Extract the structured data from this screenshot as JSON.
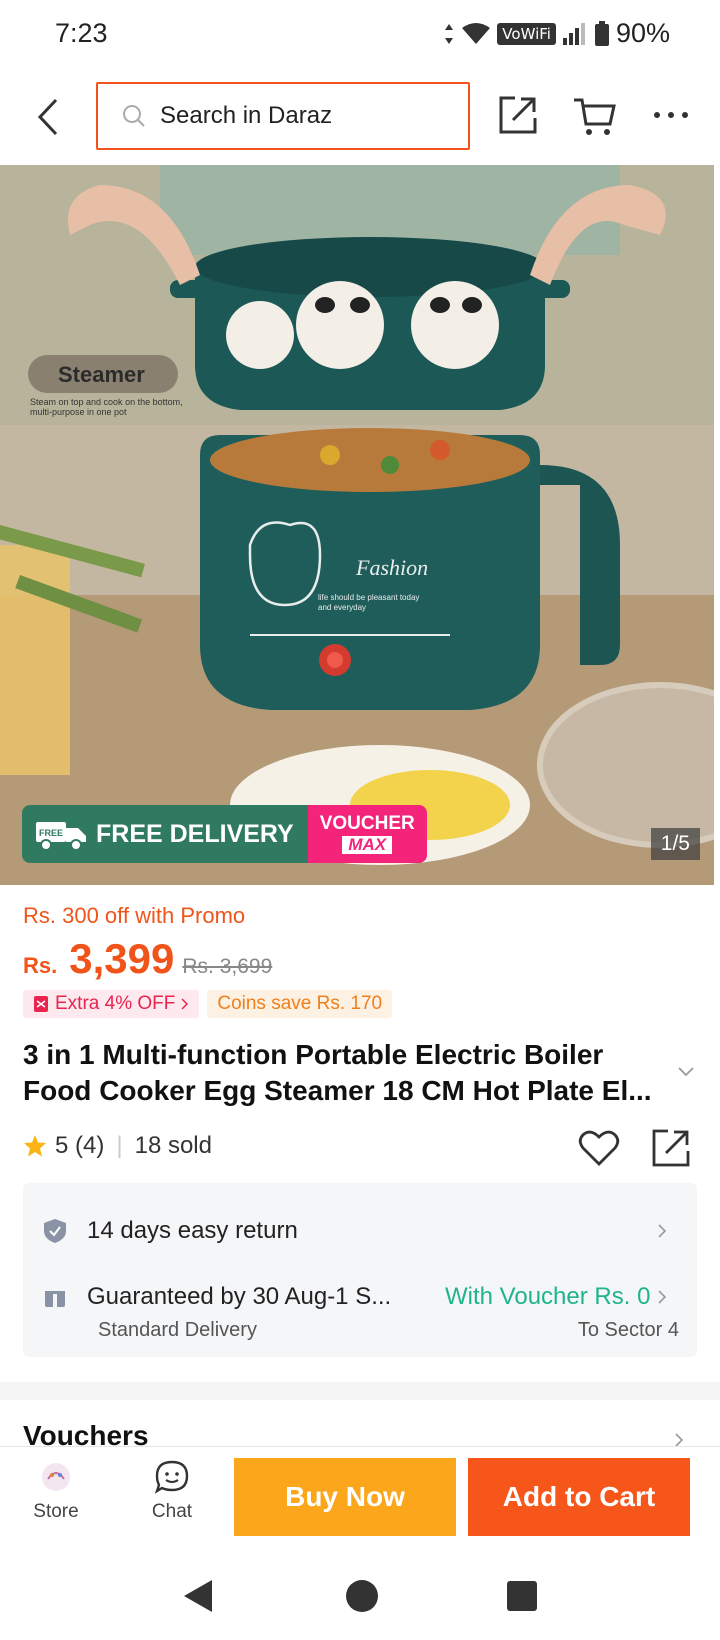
{
  "status_bar": {
    "time": "7:23",
    "vowifi": "VoWiFi",
    "battery": "90%"
  },
  "header": {
    "search_placeholder": "Search in Daraz",
    "icons": [
      "back-arrow-icon",
      "search-icon",
      "share-icon",
      "cart-icon",
      "more-icon"
    ]
  },
  "gallery": {
    "free_delivery_label": "FREE DELIVERY",
    "truck_badge": "FREE",
    "voucher_line1": "VOUCHER",
    "voucher_line2": "MAX",
    "image_counter": "1/5",
    "steamer_caption": "Steamer",
    "steamer_subcaption": "Steam on top and cook on the bottom, multi-purpose in one pot",
    "pot_brand": "Fashion",
    "pot_slogan": "life should be pleasant today and everyday"
  },
  "price": {
    "promo_text": "Rs. 300 off with Promo",
    "currency": "Rs.",
    "current": "3,399",
    "original": "Rs. 3,699",
    "extra_off_tag": "Extra 4% OFF",
    "coins_tag": "Coins save Rs. 170"
  },
  "product": {
    "title": "3 in 1 Multi-function Portable Electric Boiler Food Cooker Egg Steamer 18 CM Hot Plate El...",
    "rating": "5 (4)",
    "sold": "18 sold"
  },
  "services": {
    "return_label": "14 days easy return",
    "delivery_label": "Guaranteed by 30 Aug-1 S...",
    "voucher_label": "With Voucher Rs. 0",
    "delivery_type": "Standard Delivery",
    "destination": "To Sector 4"
  },
  "vouchers": {
    "title": "Vouchers"
  },
  "actions": {
    "store_label": "Store",
    "chat_label": "Chat",
    "buy_now_label": "Buy Now",
    "add_to_cart_label": "Add to Cart"
  },
  "colors": {
    "accent_orange": "#f0541a",
    "buy_now_bg": "#fba61b",
    "add_cart_bg": "#f6561a",
    "voucher_green": "#1fb48d",
    "free_delivery_green": "#2f7a61",
    "voucher_pink": "#f3247a"
  }
}
